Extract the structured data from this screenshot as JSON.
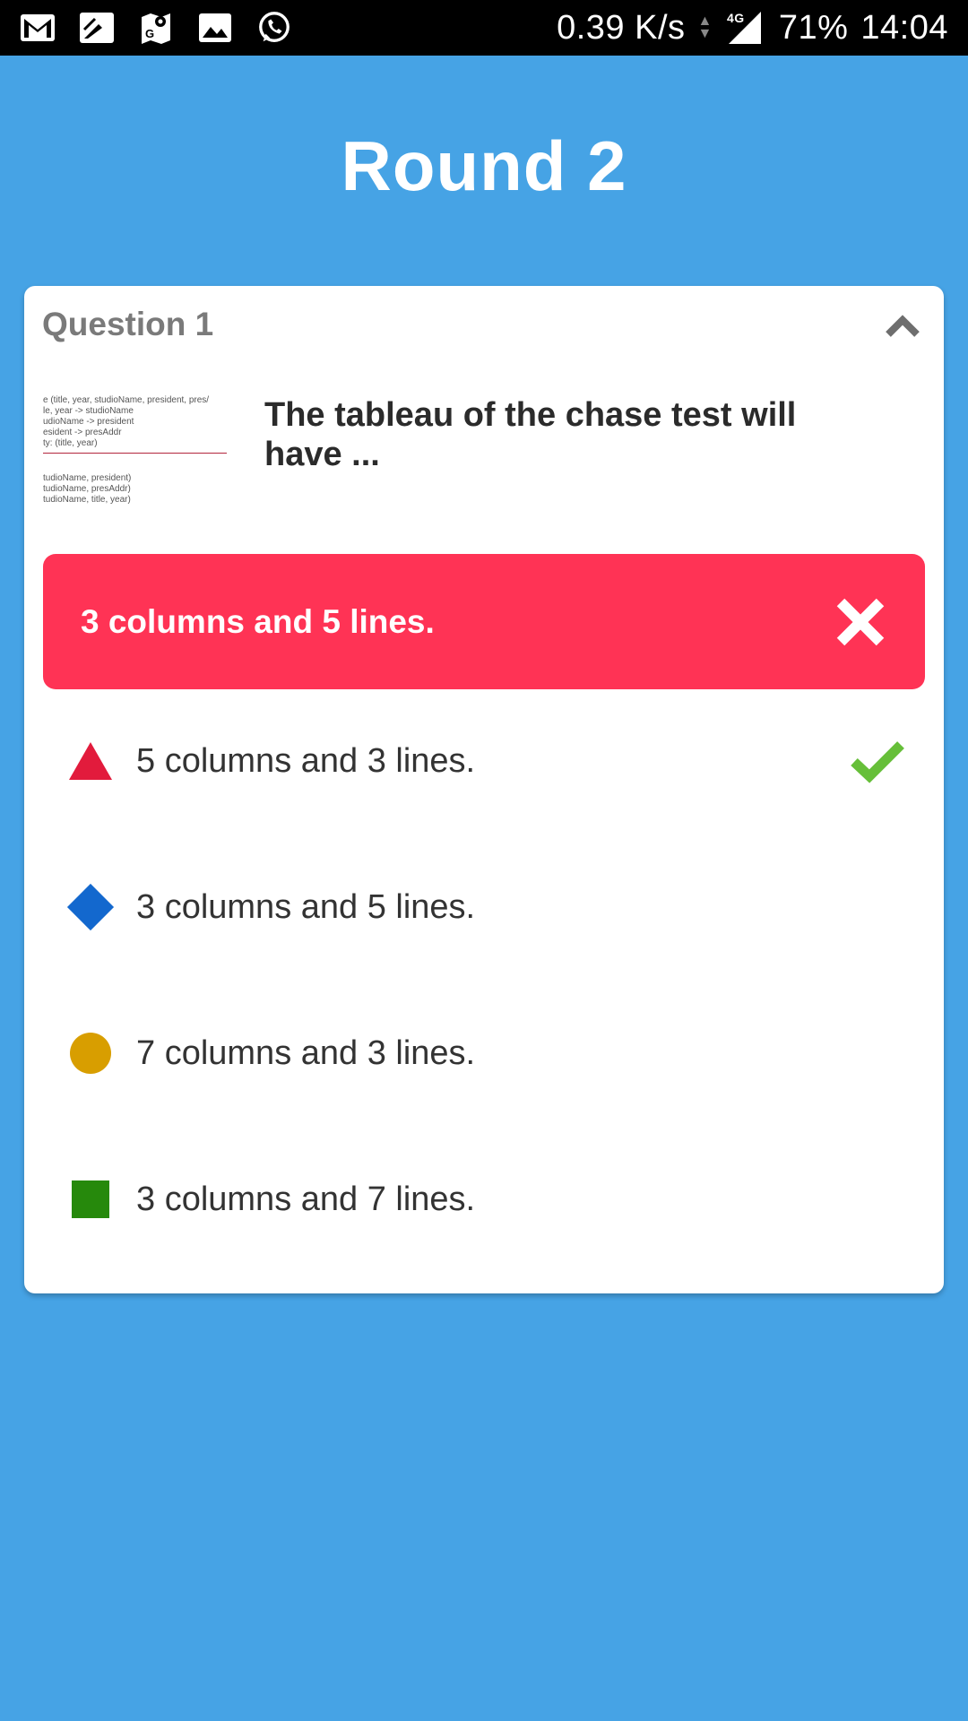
{
  "status_bar": {
    "net_speed": "0.39 K/s",
    "network_type": "4G",
    "battery": "71%",
    "time": "14:04",
    "icons": [
      "gmail-icon",
      "notes-icon",
      "maps-icon",
      "gallery-icon",
      "whatsapp-icon"
    ]
  },
  "round_title": "Round 2",
  "question": {
    "label": "Question 1",
    "text": "The tableau of the chase test will have ...",
    "thumbnail_lines": [
      "e (title, year, studioName, president, pres/",
      "le, year -> studioName",
      "udioName -> president",
      "esident -> presAddr",
      "ty: (title, year)",
      "tudioName, president)",
      "tudioName, presAddr)",
      "tudioName, title, year)"
    ]
  },
  "selected_answer": {
    "text": "3 columns and 5 lines.",
    "status": "wrong"
  },
  "options": [
    {
      "shape": "triangle-icon",
      "color": "#e21b3c",
      "text": "5 columns and 3 lines.",
      "correct": true
    },
    {
      "shape": "diamond-icon",
      "color": "#1368ce",
      "text": "3 columns and 5 lines.",
      "correct": false
    },
    {
      "shape": "circle-icon",
      "color": "#d89e00",
      "text": "7 columns and 3 lines.",
      "correct": false
    },
    {
      "shape": "square-icon",
      "color": "#26890c",
      "text": "3 columns and 7 lines.",
      "correct": false
    }
  ],
  "colors": {
    "background": "#46a3e5",
    "wrong": "#ff3355",
    "check": "#66bf39"
  }
}
